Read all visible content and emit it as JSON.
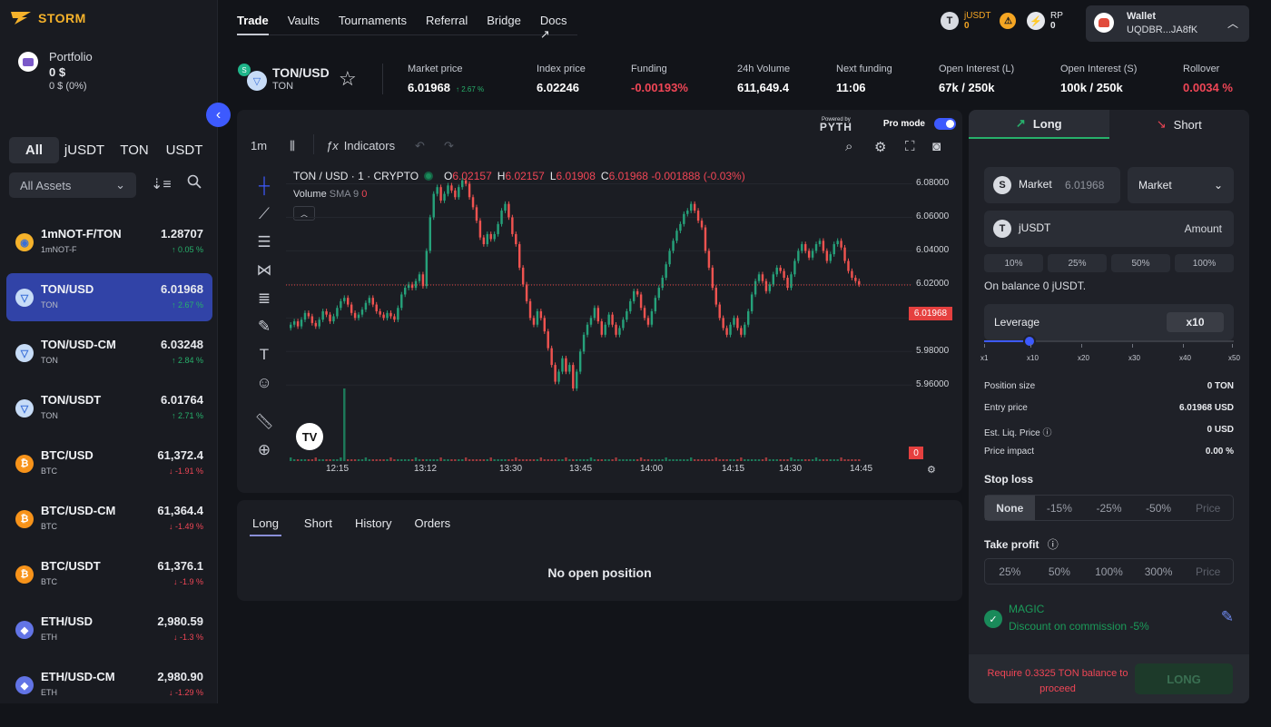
{
  "logo": {
    "text": "STORM"
  },
  "portfolio": {
    "title": "Portfolio",
    "value": "0 $",
    "sub": "0 $ (0%)"
  },
  "filters": {
    "tabs": [
      "All",
      "jUSDT",
      "TON",
      "USDT"
    ],
    "assets": "All Assets"
  },
  "markets": [
    {
      "name": "1mNOT-F/TON",
      "sub": "1mNOT-F",
      "price": "1.28707",
      "change": "↑ 0.05 %",
      "dir": "up",
      "icon_color": "#f5b22b",
      "icon": "◉"
    },
    {
      "name": "TON/USD",
      "sub": "TON",
      "price": "6.01968",
      "change": "↑ 2.67 %",
      "dir": "up",
      "icon_color": "#c7dcf7",
      "icon": "▽"
    },
    {
      "name": "TON/USD-CM",
      "sub": "TON",
      "price": "6.03248",
      "change": "↑ 2.84 %",
      "dir": "up",
      "icon_color": "#c7dcf7",
      "icon": "▽"
    },
    {
      "name": "TON/USDT",
      "sub": "TON",
      "price": "6.01764",
      "change": "↑ 2.71 %",
      "dir": "up",
      "icon_color": "#c7dcf7",
      "icon": "▽"
    },
    {
      "name": "BTC/USD",
      "sub": "BTC",
      "price": "61,372.4",
      "change": "↓ -1.91 %",
      "dir": "dn",
      "icon_color": "#f7931a",
      "icon": "₿"
    },
    {
      "name": "BTC/USD-CM",
      "sub": "BTC",
      "price": "61,364.4",
      "change": "↓ -1.49 %",
      "dir": "dn",
      "icon_color": "#f7931a",
      "icon": "₿"
    },
    {
      "name": "BTC/USDT",
      "sub": "BTC",
      "price": "61,376.1",
      "change": "↓ -1.9 %",
      "dir": "dn",
      "icon_color": "#f7931a",
      "icon": "₿"
    },
    {
      "name": "ETH/USD",
      "sub": "ETH",
      "price": "2,980.59",
      "change": "↓ -1.3 %",
      "dir": "dn",
      "icon_color": "#6274e6",
      "icon": "◆"
    },
    {
      "name": "ETH/USD-CM",
      "sub": "ETH",
      "price": "2,980.90",
      "change": "↓ -1.29 %",
      "dir": "dn",
      "icon_color": "#6274e6",
      "icon": "◆"
    }
  ],
  "nav": {
    "items": [
      "Trade",
      "Vaults",
      "Tournaments",
      "Referral",
      "Bridge",
      "Docs ↗"
    ],
    "active": "Trade"
  },
  "balances": {
    "jusdt_label": "jUSDT",
    "jusdt_value": "0",
    "rp_label": "RP",
    "rp_value": "0"
  },
  "wallet": {
    "label": "Wallet",
    "address": "UQDBR...JA8fK"
  },
  "pair": {
    "name": "TON/USD",
    "base": "TON"
  },
  "stats": [
    {
      "label": "Market price",
      "value": "6.01968",
      "extra": "↑ 2.67 %",
      "color": "#ffffff"
    },
    {
      "label": "Index price",
      "value": "6.02246",
      "extra": "",
      "color": "#ffffff"
    },
    {
      "label": "Funding",
      "value": "-0.00193%",
      "extra": "",
      "color": "#f04656"
    },
    {
      "label": "24h Volume",
      "value": "611,649.4",
      "extra": "",
      "color": "#ffffff"
    },
    {
      "label": "Next funding",
      "value": "11:06",
      "extra": "",
      "color": "#ffffff"
    },
    {
      "label": "Open Interest (L)",
      "value": "67k  / 250k",
      "extra": "",
      "color": "#ffffff"
    },
    {
      "label": "Open Interest (S)",
      "value": "100k  / 250k",
      "extra": "",
      "color": "#ffffff"
    },
    {
      "label": "Rollover",
      "value": "0.0034 %",
      "extra": "",
      "color": "#f04656"
    }
  ],
  "chart_toolbar": {
    "interval": "1m",
    "indicators": "Indicators",
    "powered": "Powered by",
    "pyth": "PYTH",
    "pro_mode": "Pro mode"
  },
  "chart_legend": {
    "symbol": "TON / USD · 1 · CRYPTO",
    "o": "6.02157",
    "h": "6.02157",
    "l": "6.01908",
    "c": "6.01968",
    "change": "-0.001888 (-0.03%)",
    "volume_label": "Volume",
    "sma": "SMA 9",
    "vol_value": "0",
    "last_price": "6.01968",
    "vol_tag": "0"
  },
  "chart_data": {
    "type": "candlestick",
    "title": "TON / USD · 1 · CRYPTO",
    "y_ticks": [
      "6.08000",
      "6.06000",
      "6.04000",
      "6.02000",
      "6.00000",
      "5.98000",
      "5.96000"
    ],
    "ylim": [
      5.945,
      6.09
    ],
    "x_ticks": [
      "12:15",
      "13:12",
      "13:30",
      "13:45",
      "14:00",
      "14:15",
      "14:30",
      "14:45"
    ],
    "last_price": 6.01968,
    "closes": [
      5.996,
      5.998,
      5.995,
      5.999,
      6.003,
      6.001,
      5.997,
      5.995,
      5.999,
      6.004,
      6.002,
      5.998,
      6.001,
      6.006,
      6.01,
      6.012,
      6.008,
      6.003,
      6.0,
      6.002,
      6.005,
      6.009,
      6.012,
      6.008,
      6.004,
      6.002,
      6.0,
      6.003,
      6.001,
      5.999,
      6.006,
      6.014,
      6.018,
      6.02,
      6.018,
      6.022,
      6.026,
      6.019,
      6.04,
      6.06,
      6.074,
      6.078,
      6.07,
      6.074,
      6.079,
      6.076,
      6.072,
      6.078,
      6.082,
      6.08,
      6.072,
      6.066,
      6.058,
      6.048,
      6.044,
      6.05,
      6.047,
      6.05,
      6.056,
      6.064,
      6.068,
      6.06,
      6.05,
      6.044,
      6.03,
      6.02,
      6.01,
      6.0,
      5.996,
      6.004,
      6.0,
      5.992,
      5.982,
      5.972,
      5.962,
      5.968,
      5.976,
      5.968,
      5.972,
      5.958,
      5.968,
      5.98,
      5.99,
      5.996,
      6.0,
      6.006,
      5.998,
      5.99,
      5.996,
      6.002,
      5.996,
      5.99,
      5.994,
      5.999,
      6.004,
      6.01,
      6.016,
      6.014,
      6.006,
      6.0,
      5.996,
      6.004,
      6.012,
      6.018,
      6.024,
      6.032,
      6.04,
      6.046,
      6.052,
      6.056,
      6.062,
      6.064,
      6.068,
      6.064,
      6.058,
      6.054,
      6.04,
      6.03,
      6.018,
      6.008,
      6.0,
      5.994,
      5.99,
      5.996,
      6.0,
      5.994,
      5.99,
      5.996,
      6.004,
      6.014,
      6.022,
      6.026,
      6.022,
      6.016,
      6.02,
      6.026,
      6.03,
      6.028,
      6.024,
      6.018,
      6.026,
      6.034,
      6.04,
      6.044,
      6.04,
      6.036,
      6.04,
      6.044,
      6.046,
      6.04,
      6.034,
      6.038,
      6.044,
      6.046,
      6.042,
      6.034,
      6.028,
      6.024,
      6.022,
      6.02
    ]
  },
  "positions": {
    "tabs": [
      "Long",
      "Short",
      "History",
      "Orders"
    ],
    "active": "Long",
    "empty": "No open position"
  },
  "order": {
    "long": "Long",
    "short": "Short",
    "market_label": "Market",
    "market_price": "6.01968",
    "type": "Market",
    "token": "jUSDT",
    "amount_placeholder": "Amount",
    "pcts": [
      "10%",
      "25%",
      "50%",
      "100%"
    ],
    "on_balance": "On balance 0 jUSDT.",
    "leverage_label": "Leverage",
    "leverage_value": "x10",
    "leverage_fraction": 0.18,
    "lev_ticks": [
      "x1",
      "x10",
      "x20",
      "x30",
      "x40",
      "x50"
    ],
    "rows": [
      {
        "k": "Position size",
        "v": "0 TON"
      },
      {
        "k": "Entry price",
        "v": "6.01968 USD"
      },
      {
        "k": "Est. Liq. Price ⓘ",
        "v": "0 USD"
      },
      {
        "k": "Price impact",
        "v": "0.00 %"
      }
    ],
    "stop_loss": {
      "title": "Stop loss",
      "options": [
        "None",
        "-15%",
        "-25%",
        "-50%",
        "Price"
      ]
    },
    "take_profit": {
      "title": "Take profit",
      "options": [
        "25%",
        "50%",
        "100%",
        "300%",
        "Price"
      ]
    },
    "magic": {
      "title": "MAGIC",
      "desc": "Discount on commission -5%"
    },
    "require": "Require 0.3325 TON balance to proceed",
    "submit": "LONG"
  },
  "colors": {
    "accent": "#3d5afe",
    "up": "#27b06b",
    "down": "#f04656",
    "candle_up": "#26a17a",
    "candle_down": "#ef5350"
  }
}
